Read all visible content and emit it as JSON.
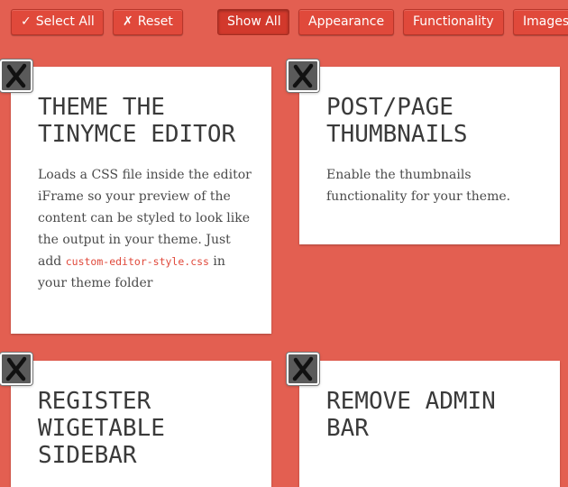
{
  "toolbar": {
    "select_all": {
      "glyph": "✓",
      "label": "Select All"
    },
    "reset": {
      "glyph": "✗",
      "label": "Reset"
    },
    "filters": {
      "show_all": "Show All",
      "appearance": "Appearance",
      "functionality": "Functionality",
      "images": "Images"
    },
    "active_filter": "Show All"
  },
  "cards": [
    {
      "title": "Theme the TinyMCE editor",
      "description_before": "Loads a CSS file inside the editor iFrame so your preview of the content can be styled to look like the output in your theme. Just add ",
      "code": "custom-editor-style.css",
      "description_after": " in your theme folder",
      "toggle_icon": "x-mark-icon"
    },
    {
      "title": "Post/Page Thumbnails",
      "description": "Enable the thumbnails functionality for your theme.",
      "toggle_icon": "x-mark-icon"
    },
    {
      "title": "Register Wigetable Sidebar",
      "toggle_icon": "x-mark-icon"
    },
    {
      "title": "Remove Admin Bar",
      "toggle_icon": "x-mark-icon"
    }
  ],
  "colors": {
    "background": "#e35f51",
    "button": "#e0493b",
    "card": "#ffffff",
    "code": "#e0493b",
    "toggle": "#5a5a5a"
  }
}
